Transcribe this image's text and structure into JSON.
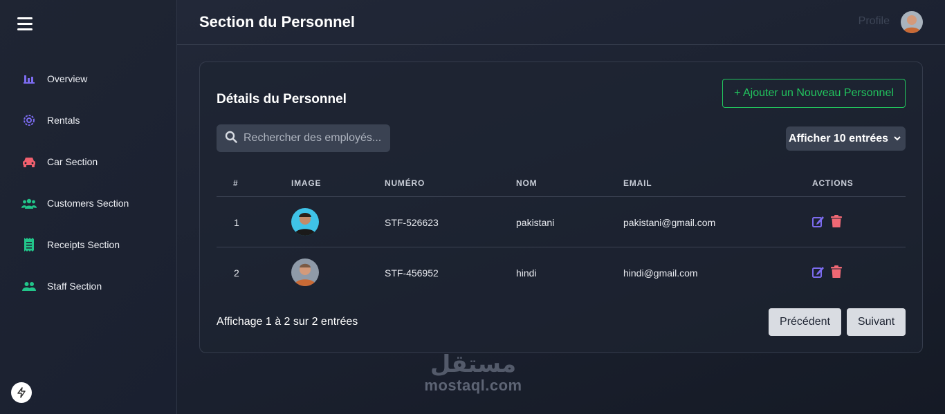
{
  "sidebar": {
    "items": [
      {
        "label": "Overview",
        "icon": "bar-chart-icon",
        "color": "#7c6cf0"
      },
      {
        "label": "Rentals",
        "icon": "gear-icon",
        "color": "#7c6cf0"
      },
      {
        "label": "Car Section",
        "icon": "car-icon",
        "color": "#f0606e"
      },
      {
        "label": "Customers Section",
        "icon": "users-icon",
        "color": "#22c58a"
      },
      {
        "label": "Receipts Section",
        "icon": "receipt-icon",
        "color": "#22c58a"
      },
      {
        "label": "Staff Section",
        "icon": "user-group-icon",
        "color": "#22c58a"
      }
    ]
  },
  "header": {
    "title": "Section du Personnel",
    "profile_label": "Profile"
  },
  "card": {
    "title": "Détails du Personnel",
    "add_button": "+ Ajouter un Nouveau Personnel",
    "search_placeholder": "Rechercher des employés...",
    "entries_select": "Afficher 10 entrées"
  },
  "table": {
    "headers": [
      "#",
      "IMAGE",
      "NUMÉRO",
      "NOM",
      "EMAIL",
      "ACTIONS"
    ],
    "rows": [
      {
        "index": "1",
        "number": "STF-526623",
        "name": "pakistani",
        "email": "pakistani@gmail.com",
        "avatar_bg": "#3fc3e8"
      },
      {
        "index": "2",
        "number": "STF-456952",
        "name": "hindi",
        "email": "hindi@gmail.com",
        "avatar_bg": "#8f9aa8"
      }
    ]
  },
  "pagination": {
    "info": "Affichage 1 à 2 sur 2 entrées",
    "prev": "Précédent",
    "next": "Suivant"
  },
  "watermark": {
    "arabic": "مستقل",
    "latin": "mostaql.com"
  },
  "colors": {
    "accent_green": "#22c55e",
    "edit_icon": "#7c6cf0",
    "delete_icon": "#f06874"
  }
}
